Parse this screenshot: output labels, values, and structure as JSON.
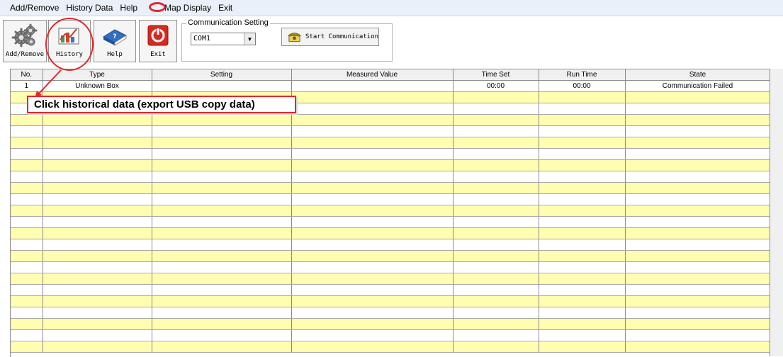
{
  "menu": {
    "items": [
      "Add/Remove",
      "History Data",
      "Help",
      "Map Display",
      "Exit"
    ]
  },
  "toolbar": {
    "buttons": [
      {
        "label": "Add/Remove",
        "icon": "gears-icon"
      },
      {
        "label": "History",
        "icon": "chart-icon"
      },
      {
        "label": "Help",
        "icon": "book-icon"
      },
      {
        "label": "Exit",
        "icon": "power-icon"
      }
    ],
    "comm": {
      "title": "Communication Setting",
      "port": "COM1",
      "start_label": "Start Communication"
    }
  },
  "grid": {
    "columns": [
      "No.",
      "Type",
      "Setting",
      "Measured Value",
      "Time Set",
      "Run Time",
      "State"
    ],
    "rows": [
      [
        "1",
        "Unknown Box",
        "",
        "",
        "00:00",
        "00:00",
        "Communication Failed"
      ]
    ]
  },
  "annotation": {
    "callout": "Click historical data (export USB copy data)"
  },
  "colors": {
    "highlight_red": "#e3282d",
    "row_yellow": "#fefdb0",
    "menubar_bg": "#eaf0fa"
  }
}
